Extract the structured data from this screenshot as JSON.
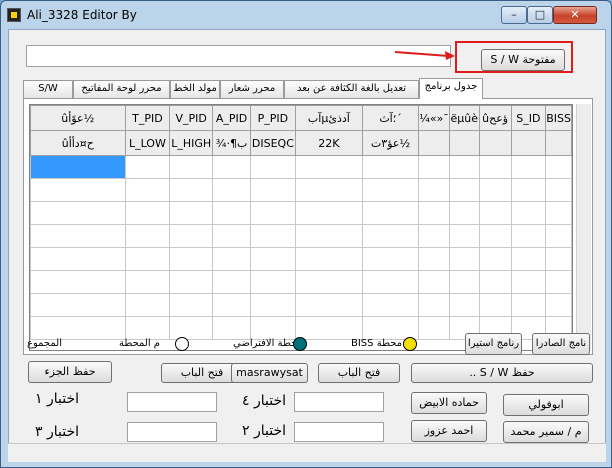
{
  "window": {
    "title": "Ali_3328 Editor By",
    "minimize": "–",
    "maximize": "□",
    "close": "✕"
  },
  "top": {
    "text_value": "",
    "sw_button": "S / W مفتوحة",
    "highlight_color": "#e01b1b"
  },
  "tabs": [
    "جدول برنامج",
    "تعديل بالغة الكثافة عن بعد",
    "محرر شعار",
    "مولد الخط",
    "محرر لوحة المفاتيح",
    "S/W"
  ],
  "grid": {
    "headers": [
      "ûعوًأ½",
      "T_PID",
      "V_PID",
      "A_PID",
      "P_PID",
      "آبµآدذئ",
      "؛آث´",
      "¼«»¯",
      "ëµûè",
      "ûؤعح",
      "S_ID",
      "BISS"
    ],
    "row1": [
      "ûح¤دأأ",
      "L_LOW",
      "L_HIGH",
      "¾·¶ب",
      "DISEQC",
      "22K",
      "عؤ٣ت½",
      "",
      "",
      "",
      "",
      ""
    ],
    "selection_color": "#3399ff"
  },
  "legend": {
    "sum_label": "المجموع",
    "station_white": "م المحطة",
    "station_default": "محطة الافتراضي",
    "station_biss": "BISS محطة",
    "btn_istera": "رنامج استيرا",
    "btn_export": "نامج الصادرا"
  },
  "buttons": {
    "save_part": "حفظ الجزء",
    "open_door1": "فتح الباب",
    "masrawysat": "masrawysat",
    "open_door2": "فتح الباب",
    "save_sw": ".. S / W حفظ",
    "hamada": "حماده الابيض",
    "aboffoly": "ابوفولي",
    "ahmed": "احمد عزوز",
    "samir": "م / سمير محمد"
  },
  "labels": {
    "test1": "اختبار ١",
    "test4": "اختبار ٤",
    "test3": "اختبار ٣",
    "test2": "اختبار ٢"
  }
}
